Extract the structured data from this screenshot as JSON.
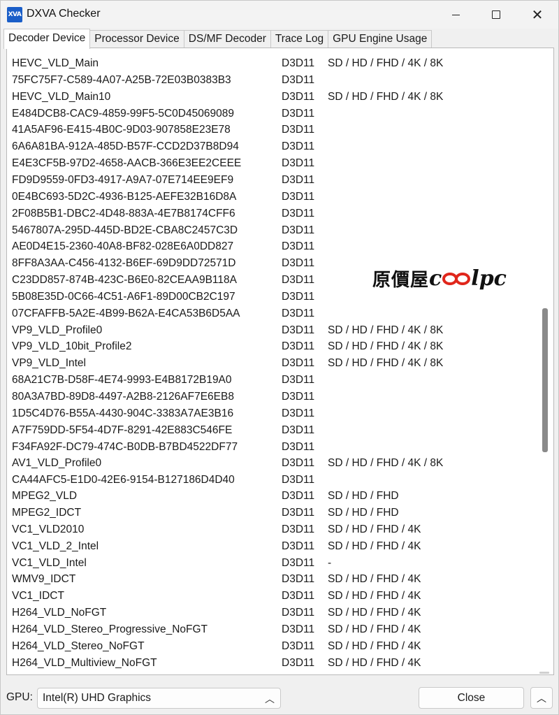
{
  "window": {
    "app_icon_text": "XVA",
    "title": "DXVA Checker"
  },
  "tabs": [
    {
      "label": "Decoder Device",
      "active": true
    },
    {
      "label": "Processor Device",
      "active": false
    },
    {
      "label": "DS/MF Decoder",
      "active": false
    },
    {
      "label": "Trace Log",
      "active": false
    },
    {
      "label": "GPU Engine Usage",
      "active": false
    }
  ],
  "decoders": [
    {
      "name": "HEVC_VLD_Main",
      "api": "D3D11",
      "resolutions": "SD / HD / FHD / 4K / 8K"
    },
    {
      "name": "75FC75F7-C589-4A07-A25B-72E03B0383B3",
      "api": "D3D11",
      "resolutions": ""
    },
    {
      "name": "HEVC_VLD_Main10",
      "api": "D3D11",
      "resolutions": "SD / HD / FHD / 4K / 8K"
    },
    {
      "name": "E484DCB8-CAC9-4859-99F5-5C0D45069089",
      "api": "D3D11",
      "resolutions": ""
    },
    {
      "name": "41A5AF96-E415-4B0C-9D03-907858E23E78",
      "api": "D3D11",
      "resolutions": ""
    },
    {
      "name": "6A6A81BA-912A-485D-B57F-CCD2D37B8D94",
      "api": "D3D11",
      "resolutions": ""
    },
    {
      "name": "E4E3CF5B-97D2-4658-AACB-366E3EE2CEEE",
      "api": "D3D11",
      "resolutions": ""
    },
    {
      "name": "FD9D9559-0FD3-4917-A9A7-07E714EE9EF9",
      "api": "D3D11",
      "resolutions": ""
    },
    {
      "name": "0E4BC693-5D2C-4936-B125-AEFE32B16D8A",
      "api": "D3D11",
      "resolutions": ""
    },
    {
      "name": "2F08B5B1-DBC2-4D48-883A-4E7B8174CFF6",
      "api": "D3D11",
      "resolutions": ""
    },
    {
      "name": "5467807A-295D-445D-BD2E-CBA8C2457C3D",
      "api": "D3D11",
      "resolutions": ""
    },
    {
      "name": "AE0D4E15-2360-40A8-BF82-028E6A0DD827",
      "api": "D3D11",
      "resolutions": ""
    },
    {
      "name": "8FF8A3AA-C456-4132-B6EF-69D9DD72571D",
      "api": "D3D11",
      "resolutions": ""
    },
    {
      "name": "C23DD857-874B-423C-B6E0-82CEAA9B118A",
      "api": "D3D11",
      "resolutions": ""
    },
    {
      "name": "5B08E35D-0C66-4C51-A6F1-89D00CB2C197",
      "api": "D3D11",
      "resolutions": ""
    },
    {
      "name": "07CFAFFB-5A2E-4B99-B62A-E4CA53B6D5AA",
      "api": "D3D11",
      "resolutions": ""
    },
    {
      "name": "VP9_VLD_Profile0",
      "api": "D3D11",
      "resolutions": "SD / HD / FHD / 4K / 8K"
    },
    {
      "name": "VP9_VLD_10bit_Profile2",
      "api": "D3D11",
      "resolutions": "SD / HD / FHD / 4K / 8K"
    },
    {
      "name": "VP9_VLD_Intel",
      "api": "D3D11",
      "resolutions": "SD / HD / FHD / 4K / 8K"
    },
    {
      "name": "68A21C7B-D58F-4E74-9993-E4B8172B19A0",
      "api": "D3D11",
      "resolutions": ""
    },
    {
      "name": "80A3A7BD-89D8-4497-A2B8-2126AF7E6EB8",
      "api": "D3D11",
      "resolutions": ""
    },
    {
      "name": "1D5C4D76-B55A-4430-904C-3383A7AE3B16",
      "api": "D3D11",
      "resolutions": ""
    },
    {
      "name": "A7F759DD-5F54-4D7F-8291-42E883C546FE",
      "api": "D3D11",
      "resolutions": ""
    },
    {
      "name": "F34FA92F-DC79-474C-B0DB-B7BD4522DF77",
      "api": "D3D11",
      "resolutions": ""
    },
    {
      "name": "AV1_VLD_Profile0",
      "api": "D3D11",
      "resolutions": "SD / HD / FHD / 4K / 8K"
    },
    {
      "name": "CA44AFC5-E1D0-42E6-9154-B127186D4D40",
      "api": "D3D11",
      "resolutions": ""
    },
    {
      "name": "MPEG2_VLD",
      "api": "D3D11",
      "resolutions": "SD / HD / FHD"
    },
    {
      "name": "MPEG2_IDCT",
      "api": "D3D11",
      "resolutions": "SD / HD / FHD"
    },
    {
      "name": "VC1_VLD2010",
      "api": "D3D11",
      "resolutions": "SD / HD / FHD / 4K"
    },
    {
      "name": "VC1_VLD_2_Intel",
      "api": "D3D11",
      "resolutions": "SD / HD / FHD / 4K"
    },
    {
      "name": "VC1_VLD_Intel",
      "api": "D3D11",
      "resolutions": "-"
    },
    {
      "name": "WMV9_IDCT",
      "api": "D3D11",
      "resolutions": "SD / HD / FHD / 4K"
    },
    {
      "name": "VC1_IDCT",
      "api": "D3D11",
      "resolutions": "SD / HD / FHD / 4K"
    },
    {
      "name": "H264_VLD_NoFGT",
      "api": "D3D11",
      "resolutions": "SD / HD / FHD / 4K"
    },
    {
      "name": "H264_VLD_Stereo_Progressive_NoFGT",
      "api": "D3D11",
      "resolutions": "SD / HD / FHD / 4K"
    },
    {
      "name": "H264_VLD_Stereo_NoFGT",
      "api": "D3D11",
      "resolutions": "SD / HD / FHD / 4K"
    },
    {
      "name": "H264_VLD_Multiview_NoFGT",
      "api": "D3D11",
      "resolutions": "SD / HD / FHD / 4K"
    }
  ],
  "watermark": {
    "text_cn": "原價屋",
    "text_en_1": "c",
    "text_en_2": "lpc"
  },
  "footer": {
    "gpu_label": "GPU:",
    "gpu_selected": "Intel(R) UHD Graphics",
    "close_label": "Close"
  },
  "colors": {
    "app_icon_bg": "#1a5ec8",
    "list_bg": "#ffffff",
    "window_bg": "#f0f0f0",
    "scroll_thumb": "#8a8a8a"
  }
}
